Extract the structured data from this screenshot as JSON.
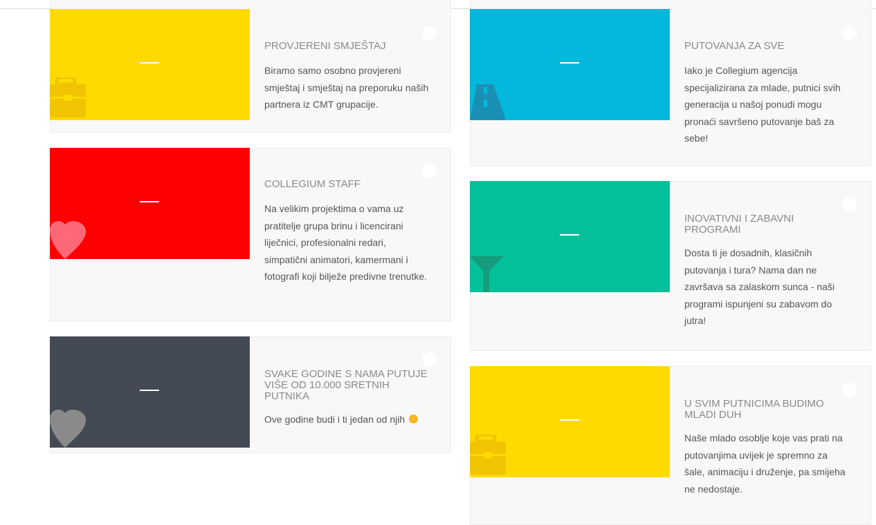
{
  "colors": {
    "yellow": "#ffda00",
    "red": "#ff0000",
    "dark": "#434a54",
    "cyan": "#03b8db",
    "green": "#02c19a"
  },
  "cards": [
    {
      "title": "PROVJERENI SMJEŠTAJ",
      "text": "Biramo samo osobno provjereni smještaj i smještaj na preporuku naših partnera iz CMT grupacije.",
      "icon": "suitcase-icon"
    },
    {
      "title": "COLLEGIUM STAFF",
      "text": "Na velikim projektima o vama uz pratitelje grupa brinu i licencirani liječnici, profesionalni redari, simpatični animatori, kamermani i fotografi koji bilježe predivne trenutke.",
      "icon": "heart-icon"
    },
    {
      "title": "SVAKE GODINE S NAMA PUTUJE VIŠE OD 10.000 SRETNIH PUTNIKA",
      "text": "Ove godine budi i ti jedan od njih",
      "icon": "heart-icon"
    },
    {
      "title": "PUTOVANJA ZA SVE",
      "text": "Iako je Collegium agencija specijalizirana za mlade, putnici svih generacija u našoj ponudi mogu pronaći savršeno putovanje baš za sebe!",
      "icon": "road-icon"
    },
    {
      "title": "INOVATIVNI I ZABAVNI PROGRAMI",
      "text": "Dosta ti je dosadnih, klasičnih putovanja i tura? Nama dan ne završava sa zalaskom sunca - naši programi ispunjeni su zabavom do jutra!",
      "icon": "cocktail-icon"
    },
    {
      "title": "U SVIM PUTNICIMA BUDIMO MLADI DUH",
      "text": "Naše mlado osoblje koje vas prati na putovanjima uvijek je spremno za šale, animaciju i druženje, pa smijeha ne nedostaje.",
      "icon": "suitcase-icon"
    }
  ]
}
